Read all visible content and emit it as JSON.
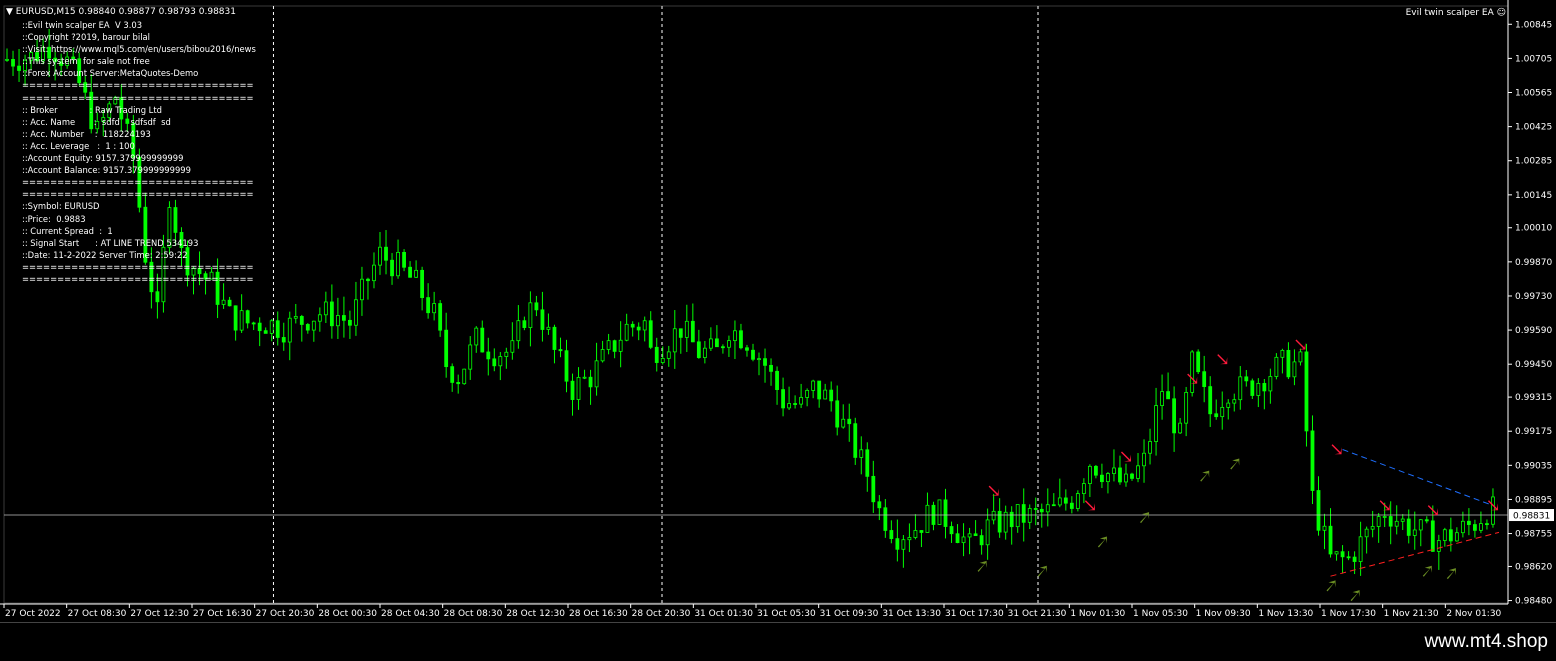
{
  "symbol_header": {
    "symbol": "EURUSD,M15",
    "ohlc": "0.98840 0.98877 0.98793 0.98831"
  },
  "ea_label": "Evil twin scalper EA ☺",
  "info_lines": [
    "::Evil twin scalper EA  V 3.03",
    "::Copyright ?2019, barour bilal",
    "::Visit: https://www.mql5.com/en/users/bibou2016/news",
    "::This system  for sale not free",
    "::Forex Account Server:MetaQuotes-Demo",
    "=================================",
    "=================================",
    ":: Broker            : Raw Trading Ltd",
    ":: Acc. Name       :  sdfd    sdfsdf  sd",
    ":: Acc. Number    :  118224193",
    ":: Acc. Leverage   :  1 : 100",
    "::Account Equity: 9157.379999999999",
    "::Account Balance: 9157.379999999999",
    "=================================",
    "=================================",
    "::Symbol: EURUSD",
    "::Price:  0.9883",
    ":: Current Spread  :  1",
    ":: Signal Start      : AT LINE TREND 534193",
    "::Date: 11-2-2022 Server Time: 2:59:22",
    "=================================",
    "================================="
  ],
  "footer_brand": "www.mt4.shop",
  "colors": {
    "candle": "#00ff00",
    "sell_arrow": "#ff1a3c",
    "buy_arrow": "#6b8e23",
    "resistance": "#1e6fff",
    "support": "#ff2020",
    "price_line": "#c0c0c0",
    "separator": "#ffffff"
  },
  "chart_data": {
    "type": "candlestick",
    "symbol": "EURUSD",
    "timeframe": "M15",
    "current_price": "0.98831",
    "y_ticks": [
      "1.00845",
      "1.00705",
      "1.00565",
      "1.00425",
      "1.00285",
      "1.00145",
      "1.00010",
      "0.99870",
      "0.99730",
      "0.99590",
      "0.99450",
      "0.99315",
      "0.99175",
      "0.99035",
      "0.98895",
      "0.98755",
      "0.98620",
      "0.98480"
    ],
    "ylim": [
      0.9847,
      1.0092
    ],
    "x_ticks": [
      "27 Oct 2022",
      "27 Oct 08:30",
      "27 Oct 12:30",
      "27 Oct 16:30",
      "27 Oct 20:30",
      "28 Oct 00:30",
      "28 Oct 04:30",
      "28 Oct 08:30",
      "28 Oct 12:30",
      "28 Oct 16:30",
      "28 Oct 20:30",
      "31 Oct 01:30",
      "31 Oct 05:30",
      "31 Oct 09:30",
      "31 Oct 13:30",
      "31 Oct 17:30",
      "31 Oct 21:30",
      "1 Nov 01:30",
      "1 Nov 05:30",
      "1 Nov 09:30",
      "1 Nov 13:30",
      "1 Nov 17:30",
      "1 Nov 21:30",
      "2 Nov 01:30"
    ],
    "close_path": [
      [
        0,
        1.007
      ],
      [
        5,
        1.0071
      ],
      [
        8,
        1.0076
      ],
      [
        11,
        1.0069
      ],
      [
        13,
        1.006
      ],
      [
        16,
        1.004
      ],
      [
        19,
        1.0055
      ],
      [
        22,
        1.003
      ],
      [
        24,
        0.999
      ],
      [
        26,
        0.9965
      ],
      [
        28,
        1.0015
      ],
      [
        30,
        0.999
      ],
      [
        32,
        0.9985
      ],
      [
        35,
        0.9978
      ],
      [
        38,
        0.9965
      ],
      [
        41,
        0.9962
      ],
      [
        44,
        0.9962
      ],
      [
        47,
        0.996
      ],
      [
        50,
        0.9963
      ],
      [
        53,
        0.9966
      ],
      [
        56,
        0.9965
      ],
      [
        58,
        0.9962
      ],
      [
        61,
        0.998
      ],
      [
        63,
        0.999
      ],
      [
        66,
        0.9985
      ],
      [
        69,
        0.9978
      ],
      [
        72,
        0.9965
      ],
      [
        74,
        0.9945
      ],
      [
        76,
        0.994
      ],
      [
        79,
        0.9955
      ],
      [
        82,
        0.995
      ],
      [
        85,
        0.995
      ],
      [
        87,
        0.9965
      ],
      [
        89,
        0.997
      ],
      [
        92,
        0.995
      ],
      [
        95,
        0.9935
      ],
      [
        98,
        0.994
      ],
      [
        101,
        0.995
      ],
      [
        104,
        0.996
      ],
      [
        107,
        0.9962
      ],
      [
        108,
        0.995
      ],
      [
        111,
        0.9955
      ],
      [
        113,
        0.996
      ],
      [
        116,
        0.995
      ],
      [
        119,
        0.995
      ],
      [
        121,
        0.996
      ],
      [
        124,
        0.9955
      ],
      [
        127,
        0.9945
      ],
      [
        130,
        0.993
      ],
      [
        133,
        0.9928
      ],
      [
        135,
        0.9935
      ],
      [
        138,
        0.993
      ],
      [
        141,
        0.9915
      ],
      [
        144,
        0.99
      ],
      [
        146,
        0.9885
      ],
      [
        149,
        0.9875
      ],
      [
        152,
        0.9878
      ],
      [
        155,
        0.9885
      ],
      [
        158,
        0.988
      ],
      [
        161,
        0.987
      ],
      [
        164,
        0.9878
      ],
      [
        166,
        0.988
      ],
      [
        169,
        0.9882
      ],
      [
        172,
        0.9883
      ],
      [
        175,
        0.9885
      ],
      [
        178,
        0.989
      ],
      [
        181,
        0.9905
      ],
      [
        184,
        0.99
      ],
      [
        187,
        0.9895
      ],
      [
        190,
        0.9905
      ],
      [
        193,
        0.9935
      ],
      [
        196,
        0.9915
      ],
      [
        198,
        0.9945
      ],
      [
        201,
        0.9925
      ],
      [
        204,
        0.9935
      ],
      [
        207,
        0.9935
      ],
      [
        210,
        0.994
      ],
      [
        213,
        0.9945
      ],
      [
        216,
        0.9945
      ],
      [
        218,
        0.989
      ],
      [
        221,
        0.9865
      ],
      [
        224,
        0.9865
      ],
      [
        227,
        0.9875
      ],
      [
        230,
        0.9885
      ],
      [
        233,
        0.988
      ],
      [
        236,
        0.9876
      ],
      [
        239,
        0.9873
      ],
      [
        242,
        0.9876
      ],
      [
        245,
        0.988
      ],
      [
        247,
        0.9885
      ]
    ],
    "sell_arrow_points": [
      [
        164,
        0.9889
      ],
      [
        180,
        0.9883
      ],
      [
        186,
        0.9903
      ],
      [
        197,
        0.9935
      ],
      [
        202,
        0.9943
      ],
      [
        215,
        0.9949
      ],
      [
        221,
        0.9906
      ],
      [
        229,
        0.9883
      ],
      [
        237,
        0.9881
      ],
      [
        247,
        0.9883
      ]
    ],
    "buy_arrow_points": [
      [
        162,
        0.9868
      ],
      [
        172,
        0.9866
      ],
      [
        182,
        0.9878
      ],
      [
        189,
        0.9888
      ],
      [
        199,
        0.9905
      ],
      [
        204,
        0.991
      ],
      [
        220,
        0.986
      ],
      [
        224,
        0.9856
      ],
      [
        236,
        0.9866
      ],
      [
        240,
        0.9865
      ]
    ],
    "trendlines": [
      {
        "name": "resistance",
        "from": [
          222,
          0.991
        ],
        "to": [
          247,
          0.9887
        ]
      },
      {
        "name": "support",
        "from": [
          220,
          0.9858
        ],
        "to": [
          248,
          0.9876
        ]
      }
    ],
    "day_separators_at_ticks": [
      4.3,
      10.5,
      16.5
    ]
  }
}
